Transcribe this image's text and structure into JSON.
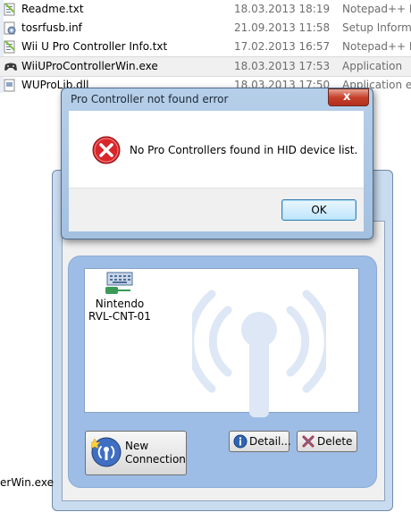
{
  "files": [
    {
      "name": "Readme.txt",
      "date": "18.03.2013 18:19",
      "type": "Notepad++ Do",
      "icon": "text-file-icon",
      "selected": false
    },
    {
      "name": "tosrfusb.inf",
      "date": "21.09.2013 11:58",
      "type": "Setup Informat",
      "icon": "setup-info-icon",
      "selected": false
    },
    {
      "name": "Wii U Pro Controller Info.txt",
      "date": "17.02.2013 16:57",
      "type": "Notepad++ Do",
      "icon": "text-file-icon",
      "selected": false
    },
    {
      "name": "WiiUProControllerWin.exe",
      "date": "18.03.2013 17:53",
      "type": "Application",
      "icon": "gamepad-icon",
      "selected": true
    },
    {
      "name": "WUProLib.dll",
      "date": "18.03.2013 17:50",
      "type": "Application ext",
      "icon": "dll-file-icon",
      "selected": false
    }
  ],
  "dialog": {
    "title": "Pro Controller not found error",
    "message": "No Pro Controllers found in HID device list.",
    "ok_label": "OK",
    "close_label": "x"
  },
  "device_window": {
    "device_name_line1": "Nintendo",
    "device_name_line2": "RVL-CNT-01",
    "new_connection_line1": "New",
    "new_connection_line2": "Connection",
    "detail_label": "Detail...",
    "delete_label": "Delete"
  },
  "taskbar": {
    "label": "erWin.exe"
  },
  "colors": {
    "error_red": "#d8262b",
    "panel_blue": "#9dbde6",
    "selection_gray": "#f0f0f0"
  }
}
